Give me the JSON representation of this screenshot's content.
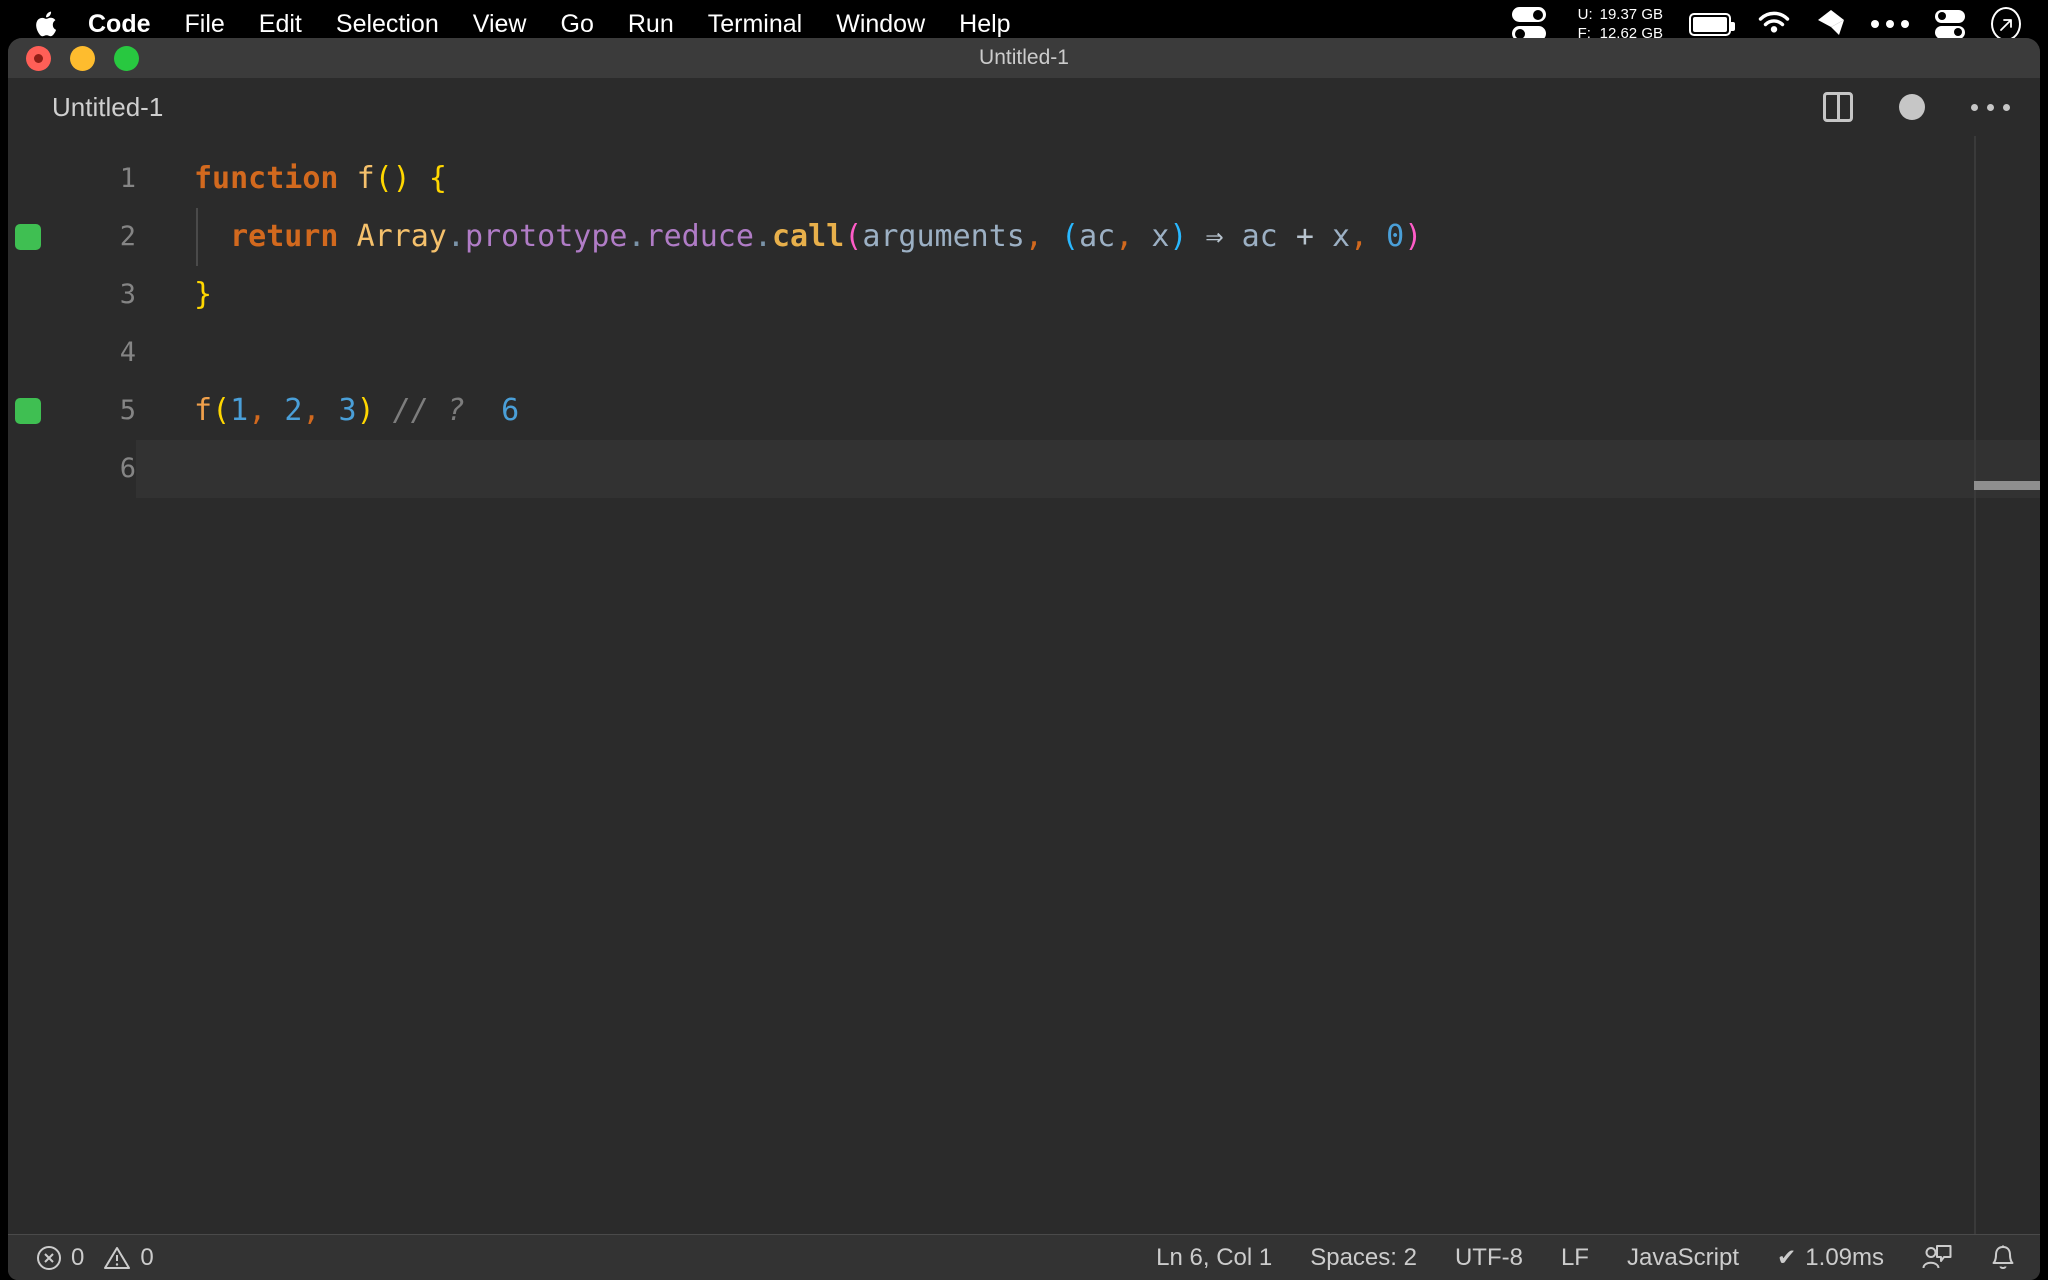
{
  "menubar": {
    "apple_icon": "apple-logo-icon",
    "items": [
      {
        "label": "Code",
        "bold": true
      },
      {
        "label": "File",
        "bold": false
      },
      {
        "label": "Edit",
        "bold": false
      },
      {
        "label": "Selection",
        "bold": false
      },
      {
        "label": "View",
        "bold": false
      },
      {
        "label": "Go",
        "bold": false
      },
      {
        "label": "Run",
        "bold": false
      },
      {
        "label": "Terminal",
        "bold": false
      },
      {
        "label": "Window",
        "bold": false
      },
      {
        "label": "Help",
        "bold": false
      }
    ],
    "status": {
      "memory_icon": "memory-toggles-icon",
      "used_key": "U:",
      "used_value": "19.37 GB",
      "free_key": "F:",
      "free_value": "12.62 GB",
      "battery_icon": "battery-full-icon",
      "wifi_icon": "wifi-icon",
      "dropbox_icon": "dropbox-icon",
      "more_icon": "ellipsis-icon",
      "control_center_icon": "control-center-icon",
      "siri_icon": "siri-icon"
    }
  },
  "window": {
    "title": "Untitled-1",
    "traffic_lights": {
      "close": "close-button",
      "minimize": "minimize-button",
      "maximize": "maximize-button"
    }
  },
  "tabbar": {
    "tab_label": "Untitled-1",
    "split_editor_icon": "split-editor-icon",
    "unsaved_indicator": "unsaved-dot-icon",
    "more_actions_icon": "more-actions-icon"
  },
  "editor": {
    "language_mode": "JavaScript",
    "lines": [
      {
        "number": "1",
        "marker": false,
        "indent_guide": false,
        "current": false,
        "tokens": [
          {
            "text": "function",
            "cls": "t-key"
          },
          {
            "text": " ",
            "cls": "t-plain"
          },
          {
            "text": "f",
            "cls": "t-fn"
          },
          {
            "text": "()",
            "cls": "t-punc-y"
          },
          {
            "text": " ",
            "cls": "t-plain"
          },
          {
            "text": "{",
            "cls": "t-punc-y"
          }
        ]
      },
      {
        "number": "2",
        "marker": true,
        "indent_guide": true,
        "current": false,
        "tokens": [
          {
            "text": "  ",
            "cls": "t-plain"
          },
          {
            "text": "return",
            "cls": "t-key"
          },
          {
            "text": " ",
            "cls": "t-plain"
          },
          {
            "text": "Array",
            "cls": "t-fn"
          },
          {
            "text": ".",
            "cls": "t-dot"
          },
          {
            "text": "prototype",
            "cls": "t-prop"
          },
          {
            "text": ".",
            "cls": "t-dot"
          },
          {
            "text": "reduce",
            "cls": "t-prop"
          },
          {
            "text": ".",
            "cls": "t-dot"
          },
          {
            "text": "call",
            "cls": "t-call"
          },
          {
            "text": "(",
            "cls": "t-punc-m"
          },
          {
            "text": "arguments",
            "cls": "t-var"
          },
          {
            "text": ",",
            "cls": "t-comma"
          },
          {
            "text": " ",
            "cls": "t-plain"
          },
          {
            "text": "(",
            "cls": "t-punc-c"
          },
          {
            "text": "ac",
            "cls": "t-var"
          },
          {
            "text": ",",
            "cls": "t-comma"
          },
          {
            "text": " ",
            "cls": "t-plain"
          },
          {
            "text": "x",
            "cls": "t-var"
          },
          {
            "text": ")",
            "cls": "t-punc-c"
          },
          {
            "text": " ",
            "cls": "t-plain"
          },
          {
            "text": "⇒",
            "cls": "t-arrow"
          },
          {
            "text": " ",
            "cls": "t-plain"
          },
          {
            "text": "ac",
            "cls": "t-var"
          },
          {
            "text": " ",
            "cls": "t-plain"
          },
          {
            "text": "+",
            "cls": "t-op"
          },
          {
            "text": " ",
            "cls": "t-plain"
          },
          {
            "text": "x",
            "cls": "t-var"
          },
          {
            "text": ",",
            "cls": "t-comma"
          },
          {
            "text": " ",
            "cls": "t-plain"
          },
          {
            "text": "0",
            "cls": "t-num"
          },
          {
            "text": ")",
            "cls": "t-punc-m"
          }
        ]
      },
      {
        "number": "3",
        "marker": false,
        "indent_guide": false,
        "current": false,
        "tokens": [
          {
            "text": "}",
            "cls": "t-punc-y"
          }
        ]
      },
      {
        "number": "4",
        "marker": false,
        "indent_guide": false,
        "current": false,
        "tokens": []
      },
      {
        "number": "5",
        "marker": true,
        "indent_guide": false,
        "current": false,
        "tokens": [
          {
            "text": "f",
            "cls": "t-fn2"
          },
          {
            "text": "(",
            "cls": "t-punc-y"
          },
          {
            "text": "1",
            "cls": "t-num"
          },
          {
            "text": ",",
            "cls": "t-comma"
          },
          {
            "text": " ",
            "cls": "t-plain"
          },
          {
            "text": "2",
            "cls": "t-num"
          },
          {
            "text": ",",
            "cls": "t-comma"
          },
          {
            "text": " ",
            "cls": "t-plain"
          },
          {
            "text": "3",
            "cls": "t-num"
          },
          {
            "text": ")",
            "cls": "t-punc-y"
          },
          {
            "text": " ",
            "cls": "t-plain"
          },
          {
            "text": "// ?",
            "cls": "t-comment"
          },
          {
            "text": "  ",
            "cls": "t-plain"
          },
          {
            "text": "6",
            "cls": "t-num"
          }
        ]
      },
      {
        "number": "6",
        "marker": false,
        "indent_guide": false,
        "current": true,
        "tokens": []
      }
    ],
    "plain_source": "function f() {\n  return Array.prototype.reduce.call(arguments, (ac, x) ⇒ ac + x, 0)\n}\n\nf(1, 2, 3) // ?  6\n"
  },
  "statusbar": {
    "errors_icon": "error-circle-icon",
    "errors_count": "0",
    "warnings_icon": "warning-triangle-icon",
    "warnings_count": "0",
    "cursor_position": "Ln 6, Col 1",
    "indentation": "Spaces: 2",
    "encoding": "UTF-8",
    "eol": "LF",
    "language": "JavaScript",
    "quokka_check": "✔",
    "quokka_time": "1.09ms",
    "feedback_icon": "feedback-icon",
    "bell_icon": "bell-icon"
  },
  "colors": {
    "menubar_bg": "#000000",
    "titlebar_bg": "#3b3b3b",
    "editor_bg": "#2b2b2b",
    "statusbar_bg": "#333333",
    "line_number": "#858585",
    "run_marker_green": "#3fbf52",
    "keyword_orange": "#d2691e",
    "number_blue": "#4a9fd8",
    "property_purple": "#b07cc6",
    "paren_yellow": "#ffd700",
    "paren_magenta": "#ff5cc8",
    "paren_cyan": "#29b8ff",
    "comment_gray": "#7d7d7d"
  }
}
